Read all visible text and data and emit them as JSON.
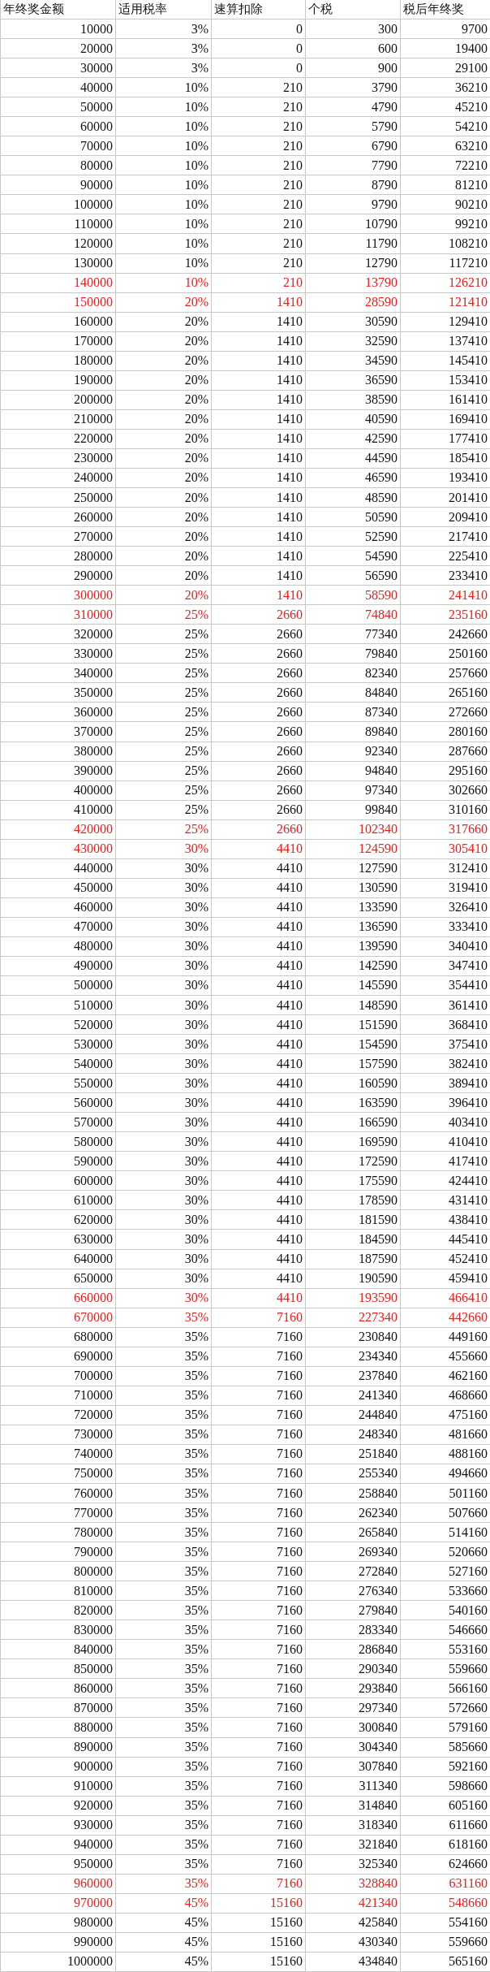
{
  "columns": [
    "年终奖金额",
    "适用税率",
    "速算扣除",
    "个税",
    "税后年终奖"
  ],
  "rows": [
    {
      "cells": [
        "10000",
        "3%",
        "0",
        "300",
        "9700"
      ],
      "highlighted": false
    },
    {
      "cells": [
        "20000",
        "3%",
        "0",
        "600",
        "19400"
      ],
      "highlighted": false
    },
    {
      "cells": [
        "30000",
        "3%",
        "0",
        "900",
        "29100"
      ],
      "highlighted": false
    },
    {
      "cells": [
        "40000",
        "10%",
        "210",
        "3790",
        "36210"
      ],
      "highlighted": false
    },
    {
      "cells": [
        "50000",
        "10%",
        "210",
        "4790",
        "45210"
      ],
      "highlighted": false
    },
    {
      "cells": [
        "60000",
        "10%",
        "210",
        "5790",
        "54210"
      ],
      "highlighted": false
    },
    {
      "cells": [
        "70000",
        "10%",
        "210",
        "6790",
        "63210"
      ],
      "highlighted": false
    },
    {
      "cells": [
        "80000",
        "10%",
        "210",
        "7790",
        "72210"
      ],
      "highlighted": false
    },
    {
      "cells": [
        "90000",
        "10%",
        "210",
        "8790",
        "81210"
      ],
      "highlighted": false
    },
    {
      "cells": [
        "100000",
        "10%",
        "210",
        "9790",
        "90210"
      ],
      "highlighted": false
    },
    {
      "cells": [
        "110000",
        "10%",
        "210",
        "10790",
        "99210"
      ],
      "highlighted": false
    },
    {
      "cells": [
        "120000",
        "10%",
        "210",
        "11790",
        "108210"
      ],
      "highlighted": false
    },
    {
      "cells": [
        "130000",
        "10%",
        "210",
        "12790",
        "117210"
      ],
      "highlighted": false
    },
    {
      "cells": [
        "140000",
        "10%",
        "210",
        "13790",
        "126210"
      ],
      "highlighted": true
    },
    {
      "cells": [
        "150000",
        "20%",
        "1410",
        "28590",
        "121410"
      ],
      "highlighted": true
    },
    {
      "cells": [
        "160000",
        "20%",
        "1410",
        "30590",
        "129410"
      ],
      "highlighted": false
    },
    {
      "cells": [
        "170000",
        "20%",
        "1410",
        "32590",
        "137410"
      ],
      "highlighted": false
    },
    {
      "cells": [
        "180000",
        "20%",
        "1410",
        "34590",
        "145410"
      ],
      "highlighted": false
    },
    {
      "cells": [
        "190000",
        "20%",
        "1410",
        "36590",
        "153410"
      ],
      "highlighted": false
    },
    {
      "cells": [
        "200000",
        "20%",
        "1410",
        "38590",
        "161410"
      ],
      "highlighted": false
    },
    {
      "cells": [
        "210000",
        "20%",
        "1410",
        "40590",
        "169410"
      ],
      "highlighted": false
    },
    {
      "cells": [
        "220000",
        "20%",
        "1410",
        "42590",
        "177410"
      ],
      "highlighted": false
    },
    {
      "cells": [
        "230000",
        "20%",
        "1410",
        "44590",
        "185410"
      ],
      "highlighted": false
    },
    {
      "cells": [
        "240000",
        "20%",
        "1410",
        "46590",
        "193410"
      ],
      "highlighted": false
    },
    {
      "cells": [
        "250000",
        "20%",
        "1410",
        "48590",
        "201410"
      ],
      "highlighted": false
    },
    {
      "cells": [
        "260000",
        "20%",
        "1410",
        "50590",
        "209410"
      ],
      "highlighted": false
    },
    {
      "cells": [
        "270000",
        "20%",
        "1410",
        "52590",
        "217410"
      ],
      "highlighted": false
    },
    {
      "cells": [
        "280000",
        "20%",
        "1410",
        "54590",
        "225410"
      ],
      "highlighted": false
    },
    {
      "cells": [
        "290000",
        "20%",
        "1410",
        "56590",
        "233410"
      ],
      "highlighted": false
    },
    {
      "cells": [
        "300000",
        "20%",
        "1410",
        "58590",
        "241410"
      ],
      "highlighted": true
    },
    {
      "cells": [
        "310000",
        "25%",
        "2660",
        "74840",
        "235160"
      ],
      "highlighted": true
    },
    {
      "cells": [
        "320000",
        "25%",
        "2660",
        "77340",
        "242660"
      ],
      "highlighted": false
    },
    {
      "cells": [
        "330000",
        "25%",
        "2660",
        "79840",
        "250160"
      ],
      "highlighted": false
    },
    {
      "cells": [
        "340000",
        "25%",
        "2660",
        "82340",
        "257660"
      ],
      "highlighted": false
    },
    {
      "cells": [
        "350000",
        "25%",
        "2660",
        "84840",
        "265160"
      ],
      "highlighted": false
    },
    {
      "cells": [
        "360000",
        "25%",
        "2660",
        "87340",
        "272660"
      ],
      "highlighted": false
    },
    {
      "cells": [
        "370000",
        "25%",
        "2660",
        "89840",
        "280160"
      ],
      "highlighted": false
    },
    {
      "cells": [
        "380000",
        "25%",
        "2660",
        "92340",
        "287660"
      ],
      "highlighted": false
    },
    {
      "cells": [
        "390000",
        "25%",
        "2660",
        "94840",
        "295160"
      ],
      "highlighted": false
    },
    {
      "cells": [
        "400000",
        "25%",
        "2660",
        "97340",
        "302660"
      ],
      "highlighted": false
    },
    {
      "cells": [
        "410000",
        "25%",
        "2660",
        "99840",
        "310160"
      ],
      "highlighted": false
    },
    {
      "cells": [
        "420000",
        "25%",
        "2660",
        "102340",
        "317660"
      ],
      "highlighted": true
    },
    {
      "cells": [
        "430000",
        "30%",
        "4410",
        "124590",
        "305410"
      ],
      "highlighted": true
    },
    {
      "cells": [
        "440000",
        "30%",
        "4410",
        "127590",
        "312410"
      ],
      "highlighted": false
    },
    {
      "cells": [
        "450000",
        "30%",
        "4410",
        "130590",
        "319410"
      ],
      "highlighted": false
    },
    {
      "cells": [
        "460000",
        "30%",
        "4410",
        "133590",
        "326410"
      ],
      "highlighted": false
    },
    {
      "cells": [
        "470000",
        "30%",
        "4410",
        "136590",
        "333410"
      ],
      "highlighted": false
    },
    {
      "cells": [
        "480000",
        "30%",
        "4410",
        "139590",
        "340410"
      ],
      "highlighted": false
    },
    {
      "cells": [
        "490000",
        "30%",
        "4410",
        "142590",
        "347410"
      ],
      "highlighted": false
    },
    {
      "cells": [
        "500000",
        "30%",
        "4410",
        "145590",
        "354410"
      ],
      "highlighted": false
    },
    {
      "cells": [
        "510000",
        "30%",
        "4410",
        "148590",
        "361410"
      ],
      "highlighted": false
    },
    {
      "cells": [
        "520000",
        "30%",
        "4410",
        "151590",
        "368410"
      ],
      "highlighted": false
    },
    {
      "cells": [
        "530000",
        "30%",
        "4410",
        "154590",
        "375410"
      ],
      "highlighted": false
    },
    {
      "cells": [
        "540000",
        "30%",
        "4410",
        "157590",
        "382410"
      ],
      "highlighted": false
    },
    {
      "cells": [
        "550000",
        "30%",
        "4410",
        "160590",
        "389410"
      ],
      "highlighted": false
    },
    {
      "cells": [
        "560000",
        "30%",
        "4410",
        "163590",
        "396410"
      ],
      "highlighted": false
    },
    {
      "cells": [
        "570000",
        "30%",
        "4410",
        "166590",
        "403410"
      ],
      "highlighted": false
    },
    {
      "cells": [
        "580000",
        "30%",
        "4410",
        "169590",
        "410410"
      ],
      "highlighted": false
    },
    {
      "cells": [
        "590000",
        "30%",
        "4410",
        "172590",
        "417410"
      ],
      "highlighted": false
    },
    {
      "cells": [
        "600000",
        "30%",
        "4410",
        "175590",
        "424410"
      ],
      "highlighted": false
    },
    {
      "cells": [
        "610000",
        "30%",
        "4410",
        "178590",
        "431410"
      ],
      "highlighted": false
    },
    {
      "cells": [
        "620000",
        "30%",
        "4410",
        "181590",
        "438410"
      ],
      "highlighted": false
    },
    {
      "cells": [
        "630000",
        "30%",
        "4410",
        "184590",
        "445410"
      ],
      "highlighted": false
    },
    {
      "cells": [
        "640000",
        "30%",
        "4410",
        "187590",
        "452410"
      ],
      "highlighted": false
    },
    {
      "cells": [
        "650000",
        "30%",
        "4410",
        "190590",
        "459410"
      ],
      "highlighted": false
    },
    {
      "cells": [
        "660000",
        "30%",
        "4410",
        "193590",
        "466410"
      ],
      "highlighted": true
    },
    {
      "cells": [
        "670000",
        "35%",
        "7160",
        "227340",
        "442660"
      ],
      "highlighted": true
    },
    {
      "cells": [
        "680000",
        "35%",
        "7160",
        "230840",
        "449160"
      ],
      "highlighted": false
    },
    {
      "cells": [
        "690000",
        "35%",
        "7160",
        "234340",
        "455660"
      ],
      "highlighted": false
    },
    {
      "cells": [
        "700000",
        "35%",
        "7160",
        "237840",
        "462160"
      ],
      "highlighted": false
    },
    {
      "cells": [
        "710000",
        "35%",
        "7160",
        "241340",
        "468660"
      ],
      "highlighted": false
    },
    {
      "cells": [
        "720000",
        "35%",
        "7160",
        "244840",
        "475160"
      ],
      "highlighted": false
    },
    {
      "cells": [
        "730000",
        "35%",
        "7160",
        "248340",
        "481660"
      ],
      "highlighted": false
    },
    {
      "cells": [
        "740000",
        "35%",
        "7160",
        "251840",
        "488160"
      ],
      "highlighted": false
    },
    {
      "cells": [
        "750000",
        "35%",
        "7160",
        "255340",
        "494660"
      ],
      "highlighted": false
    },
    {
      "cells": [
        "760000",
        "35%",
        "7160",
        "258840",
        "501160"
      ],
      "highlighted": false
    },
    {
      "cells": [
        "770000",
        "35%",
        "7160",
        "262340",
        "507660"
      ],
      "highlighted": false
    },
    {
      "cells": [
        "780000",
        "35%",
        "7160",
        "265840",
        "514160"
      ],
      "highlighted": false
    },
    {
      "cells": [
        "790000",
        "35%",
        "7160",
        "269340",
        "520660"
      ],
      "highlighted": false
    },
    {
      "cells": [
        "800000",
        "35%",
        "7160",
        "272840",
        "527160"
      ],
      "highlighted": false
    },
    {
      "cells": [
        "810000",
        "35%",
        "7160",
        "276340",
        "533660"
      ],
      "highlighted": false
    },
    {
      "cells": [
        "820000",
        "35%",
        "7160",
        "279840",
        "540160"
      ],
      "highlighted": false
    },
    {
      "cells": [
        "830000",
        "35%",
        "7160",
        "283340",
        "546660"
      ],
      "highlighted": false
    },
    {
      "cells": [
        "840000",
        "35%",
        "7160",
        "286840",
        "553160"
      ],
      "highlighted": false
    },
    {
      "cells": [
        "850000",
        "35%",
        "7160",
        "290340",
        "559660"
      ],
      "highlighted": false
    },
    {
      "cells": [
        "860000",
        "35%",
        "7160",
        "293840",
        "566160"
      ],
      "highlighted": false
    },
    {
      "cells": [
        "870000",
        "35%",
        "7160",
        "297340",
        "572660"
      ],
      "highlighted": false
    },
    {
      "cells": [
        "880000",
        "35%",
        "7160",
        "300840",
        "579160"
      ],
      "highlighted": false
    },
    {
      "cells": [
        "890000",
        "35%",
        "7160",
        "304340",
        "585660"
      ],
      "highlighted": false
    },
    {
      "cells": [
        "900000",
        "35%",
        "7160",
        "307840",
        "592160"
      ],
      "highlighted": false
    },
    {
      "cells": [
        "910000",
        "35%",
        "7160",
        "311340",
        "598660"
      ],
      "highlighted": false
    },
    {
      "cells": [
        "920000",
        "35%",
        "7160",
        "314840",
        "605160"
      ],
      "highlighted": false
    },
    {
      "cells": [
        "930000",
        "35%",
        "7160",
        "318340",
        "611660"
      ],
      "highlighted": false
    },
    {
      "cells": [
        "940000",
        "35%",
        "7160",
        "321840",
        "618160"
      ],
      "highlighted": false
    },
    {
      "cells": [
        "950000",
        "35%",
        "7160",
        "325340",
        "624660"
      ],
      "highlighted": false
    },
    {
      "cells": [
        "960000",
        "35%",
        "7160",
        "328840",
        "631160"
      ],
      "highlighted": true
    },
    {
      "cells": [
        "970000",
        "45%",
        "15160",
        "421340",
        "548660"
      ],
      "highlighted": true
    },
    {
      "cells": [
        "980000",
        "45%",
        "15160",
        "425840",
        "554160"
      ],
      "highlighted": false
    },
    {
      "cells": [
        "990000",
        "45%",
        "15160",
        "430340",
        "559660"
      ],
      "highlighted": false
    },
    {
      "cells": [
        "1000000",
        "45%",
        "15160",
        "434840",
        "565160"
      ],
      "highlighted": false
    }
  ]
}
